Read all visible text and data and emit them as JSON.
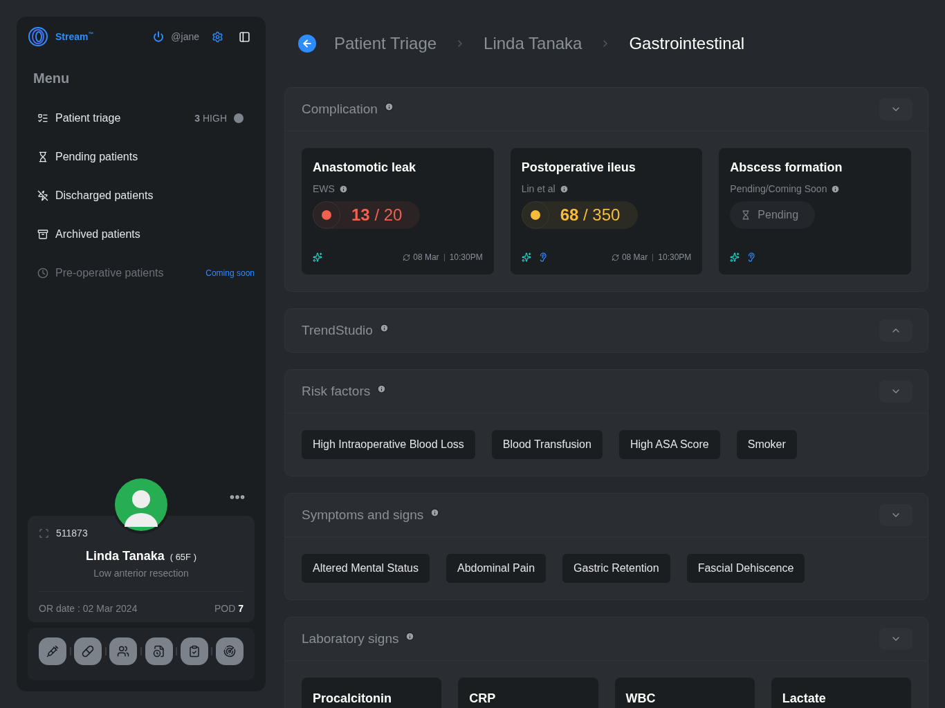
{
  "sidebar": {
    "brand": "Stream",
    "brand_mark": "™",
    "user": "@jane",
    "menu_title": "Menu",
    "items": [
      {
        "label": "Patient triage",
        "count": "3",
        "count_text": "HIGH",
        "disabled": false
      },
      {
        "label": "Pending patients",
        "disabled": false
      },
      {
        "label": "Discharged patients",
        "disabled": false
      },
      {
        "label": "Archived patients",
        "disabled": false
      },
      {
        "label": "Pre-operative patients",
        "note": "Coming soon",
        "disabled": true
      }
    ],
    "patient": {
      "id": "511873",
      "name": "Linda Tanaka",
      "age_sex": "( 65F )",
      "procedure": "Low anterior resection",
      "or_date": "OR date : 02 Mar 2024",
      "pod_label": "POD",
      "pod_value": "7"
    }
  },
  "breadcrumb": [
    {
      "label": "Patient Triage",
      "selected": false
    },
    {
      "label": "Linda Tanaka",
      "selected": false
    },
    {
      "label": "Gastrointestinal",
      "selected": true
    }
  ],
  "sections": [
    {
      "kind": "complications",
      "title": "Complication",
      "expanded": true,
      "cards": [
        {
          "title": "Anastomotic leak",
          "source": "EWS",
          "kind": "score",
          "score": "13",
          "max": "/ 20",
          "color": "#f0614f",
          "ear_icon": false,
          "date": "08 Mar",
          "time": "10:30PM"
        },
        {
          "title": "Postoperative ileus",
          "source": "Lin et al",
          "kind": "score",
          "score": "68",
          "max": "/ 350",
          "color": "#f7bd3a",
          "ear_icon": true,
          "date": "08 Mar",
          "time": "10:30PM"
        },
        {
          "title": "Abscess formation",
          "source": "Pending/Coming Soon",
          "kind": "pending",
          "pending_text": "Pending",
          "ear_icon": true
        }
      ]
    },
    {
      "kind": "empty",
      "title": "TrendStudio",
      "expanded": false
    },
    {
      "kind": "tags",
      "title": "Risk factors",
      "expanded": true,
      "tags": [
        "High Intraoperative Blood Loss",
        "Blood Transfusion",
        "High ASA Score",
        "Smoker"
      ]
    },
    {
      "kind": "tags",
      "title": "Symptoms and signs",
      "expanded": true,
      "tags": [
        "Altered Mental Status",
        "Abdominal Pain",
        "Gastric Retention",
        "Fascial Dehiscence"
      ]
    },
    {
      "kind": "labs",
      "title": "Laboratory signs",
      "expanded": true,
      "labs": [
        "Procalcitonin",
        "CRP",
        "WBC",
        "Lactate"
      ]
    }
  ]
}
